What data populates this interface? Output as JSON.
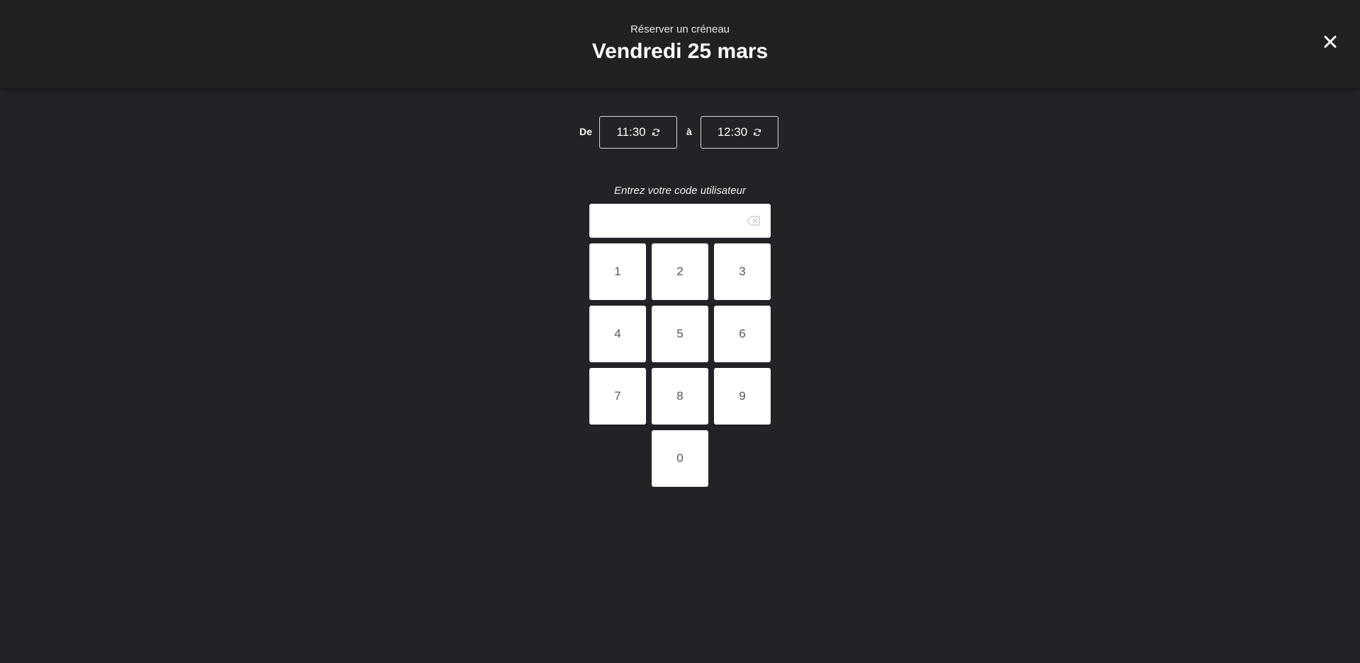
{
  "header": {
    "subtitle": "Réserver un créneau",
    "title": "Vendredi 25 mars",
    "close_icon": "close-icon"
  },
  "time_range": {
    "from_label": "De",
    "from_value": "11:30",
    "to_label": "à",
    "to_value": "12:30",
    "refresh_icon": "refresh-icon"
  },
  "code_entry": {
    "prompt": "Entrez votre code utilisateur",
    "value": "",
    "backspace_icon": "backspace-icon"
  },
  "keypad": {
    "keys": [
      "1",
      "2",
      "3",
      "4",
      "5",
      "6",
      "7",
      "8",
      "9",
      "0"
    ]
  },
  "colors": {
    "background": "#222227",
    "header_background": "#212124",
    "key_background": "#ffffff",
    "key_text": "#555555"
  }
}
